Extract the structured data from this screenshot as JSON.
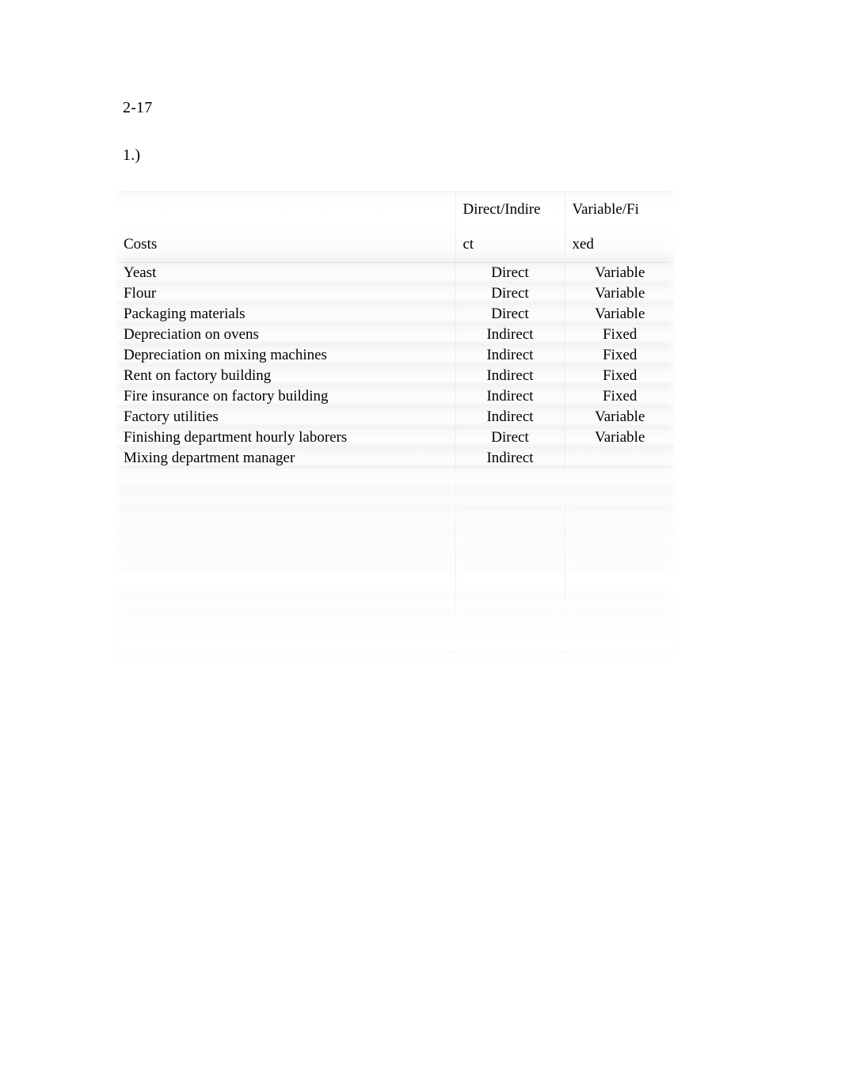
{
  "document": {
    "heading": "2-17",
    "subheading": "1.)"
  },
  "table": {
    "headers": {
      "col1_line1": "",
      "col1_line2": "Costs",
      "col2_line1": "Direct/Indire",
      "col2_line2": "ct",
      "col3_line1": "Variable/Fi",
      "col3_line2": "xed"
    },
    "rows": [
      {
        "cost": "Yeast",
        "classification": "Direct",
        "behavior": "Variable"
      },
      {
        "cost": "Flour",
        "classification": "Direct",
        "behavior": "Variable"
      },
      {
        "cost": "Packaging materials",
        "classification": "Direct",
        "behavior": "Variable"
      },
      {
        "cost": "Depreciation on ovens",
        "classification": "Indirect",
        "behavior": "Fixed"
      },
      {
        "cost": "Depreciation on mixing machines",
        "classification": "Indirect",
        "behavior": "Fixed"
      },
      {
        "cost": "Rent on factory building",
        "classification": "Indirect",
        "behavior": "Fixed"
      },
      {
        "cost": "Fire insurance on factory building",
        "classification": "Indirect",
        "behavior": "Fixed"
      },
      {
        "cost": "Factory utilities",
        "classification": "Indirect",
        "behavior": "Variable"
      },
      {
        "cost": "Finishing department hourly laborers",
        "classification": "Direct",
        "behavior": "Variable"
      },
      {
        "cost": "Mixing department manager",
        "classification": "Indirect",
        "behavior": ""
      }
    ],
    "obscured_rows": [
      {
        "cost": "",
        "classification": "",
        "behavior": ""
      },
      {
        "cost": "",
        "classification": "",
        "behavior": ""
      },
      {
        "cost": "",
        "classification": "",
        "behavior": ""
      },
      {
        "cost": "",
        "classification": "",
        "behavior": ""
      },
      {
        "cost": "",
        "classification": "",
        "behavior": ""
      },
      {
        "cost": "",
        "classification": "",
        "behavior": ""
      },
      {
        "cost": "",
        "classification": "",
        "behavior": ""
      },
      {
        "cost": "",
        "classification": "",
        "behavior": ""
      },
      {
        "cost": "",
        "classification": "",
        "behavior": ""
      }
    ]
  }
}
